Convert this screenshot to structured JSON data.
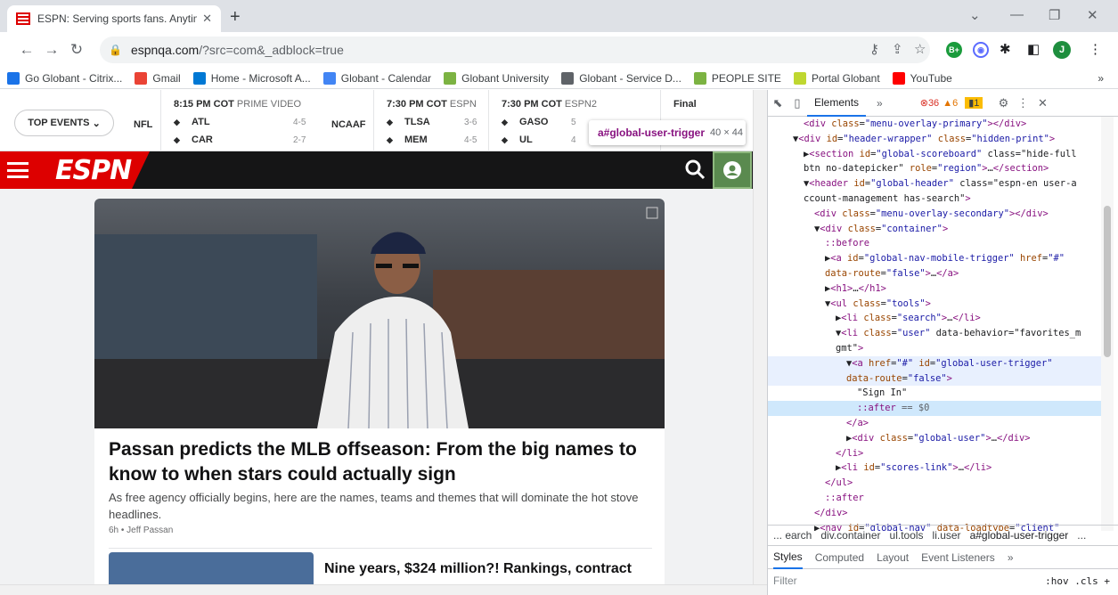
{
  "browser": {
    "tab_title": "ESPN: Serving sports fans. Anytime",
    "tab_close": "✕",
    "new_tab": "+",
    "url_host": "espnqa.com",
    "url_path": "/?src=com&_adblock=true",
    "profile_initial": "J"
  },
  "bookmarks": [
    {
      "label": "Go Globant - Citrix...",
      "icon_color": "#1a73e8"
    },
    {
      "label": "Gmail",
      "icon_color": "#ea4335"
    },
    {
      "label": "Home - Microsoft A...",
      "icon_color": "#0078d4"
    },
    {
      "label": "Globant - Calendar",
      "icon_color": "#4285f4"
    },
    {
      "label": "Globant University",
      "icon_color": "#7cb342"
    },
    {
      "label": "Globant - Service D...",
      "icon_color": "#5f6368"
    },
    {
      "label": "PEOPLE SITE",
      "icon_color": "#7cb342"
    },
    {
      "label": "Portal Globant",
      "icon_color": "#bfd730"
    },
    {
      "label": "YouTube",
      "icon_color": "#ff0000"
    }
  ],
  "bookmarks_more": "»",
  "scoreboard": {
    "top_events": "TOP EVENTS",
    "league1": "NFL",
    "league2": "NCAAF",
    "games": [
      {
        "time": "8:15 PM COT",
        "network": "PRIME VIDEO",
        "team1": "ATL",
        "rec1": "4-5",
        "team2": "CAR",
        "rec2": "2-7"
      },
      {
        "time": "7:30 PM COT",
        "network": "ESPN",
        "team1": "TLSA",
        "rec1": "3-6",
        "team2": "MEM",
        "rec2": "4-5"
      },
      {
        "time": "7:30 PM COT",
        "network": "ESPN2",
        "team1": "GASO",
        "rec1": "5",
        "team2": "UL",
        "rec2": "4"
      },
      {
        "time": "Final",
        "network": "",
        "team1": "",
        "rec1": "",
        "team2": "",
        "rec2": ""
      }
    ]
  },
  "tooltip": {
    "selector": "a#global-user-trigger",
    "size": "40 × 44"
  },
  "article": {
    "headline": "Passan predicts the MLB offseason: From the big names to know to when stars could actually sign",
    "summary": "As free agency officially begins, here are the names, teams and themes that will dominate the hot stove headlines.",
    "byline": "6h • Jeff Passan",
    "sub_headline": "Nine years, $324 million?! Rankings, contract"
  },
  "devtools": {
    "elements_tab": "Elements",
    "more_tabs": "»",
    "errors": "36",
    "warnings": "6",
    "issues": "1",
    "tree": [
      {
        "indent": 3,
        "html": "<div class=\"menu-overlay-primary\"></div>"
      },
      {
        "indent": 2,
        "html": "▼<div id=\"header-wrapper\" class=\"hidden-print\">"
      },
      {
        "indent": 3,
        "html": "▶<section id=\"global-scoreboard\" class=\"hide-full"
      },
      {
        "indent": 3,
        "html": "btn no-datepicker\" role=\"region\">…</section>"
      },
      {
        "indent": 3,
        "html": "▼<header id=\"global-header\" class=\"espn-en user-a"
      },
      {
        "indent": 3,
        "html": "ccount-management has-search\">"
      },
      {
        "indent": 4,
        "html": "<div class=\"menu-overlay-secondary\"></div>"
      },
      {
        "indent": 4,
        "html": "▼<div class=\"container\">"
      },
      {
        "indent": 5,
        "html": "::before"
      },
      {
        "indent": 5,
        "html": "▶<a id=\"global-nav-mobile-trigger\" href=\"#\""
      },
      {
        "indent": 5,
        "html": "data-route=\"false\">…</a>"
      },
      {
        "indent": 5,
        "html": "▶<h1>…</h1>"
      },
      {
        "indent": 5,
        "html": "▼<ul class=\"tools\">"
      },
      {
        "indent": 6,
        "html": "▶<li class=\"search\">…</li>"
      },
      {
        "indent": 6,
        "html": "▼<li class=\"user\" data-behavior=\"favorites_m"
      },
      {
        "indent": 6,
        "html": "gmt\">"
      },
      {
        "indent": 7,
        "html": "▼<a href=\"#\" id=\"global-user-trigger\""
      },
      {
        "indent": 7,
        "html": "data-route=\"false\">"
      },
      {
        "indent": 8,
        "html": "\"Sign In\""
      },
      {
        "indent": 8,
        "html": "::after == $0"
      },
      {
        "indent": 7,
        "html": "</a>"
      },
      {
        "indent": 7,
        "html": "▶<div class=\"global-user\">…</div>"
      },
      {
        "indent": 6,
        "html": "</li>"
      },
      {
        "indent": 6,
        "html": "▶<li id=\"scores-link\">…</li>"
      },
      {
        "indent": 5,
        "html": "</ul>"
      },
      {
        "indent": 5,
        "html": "::after"
      },
      {
        "indent": 4,
        "html": "</div>"
      },
      {
        "indent": 4,
        "html": "▶<nav id=\"global-nav\" data-loadtype=\"client\""
      }
    ],
    "breadcrumbs": [
      "... earch",
      "div.container",
      "ul.tools",
      "li.user",
      "a#global-user-trigger",
      "..."
    ],
    "panes": [
      "Styles",
      "Computed",
      "Layout",
      "Event Listeners",
      "»"
    ],
    "filter_placeholder": "Filter",
    "filter_tools": ":hov  .cls  +"
  }
}
